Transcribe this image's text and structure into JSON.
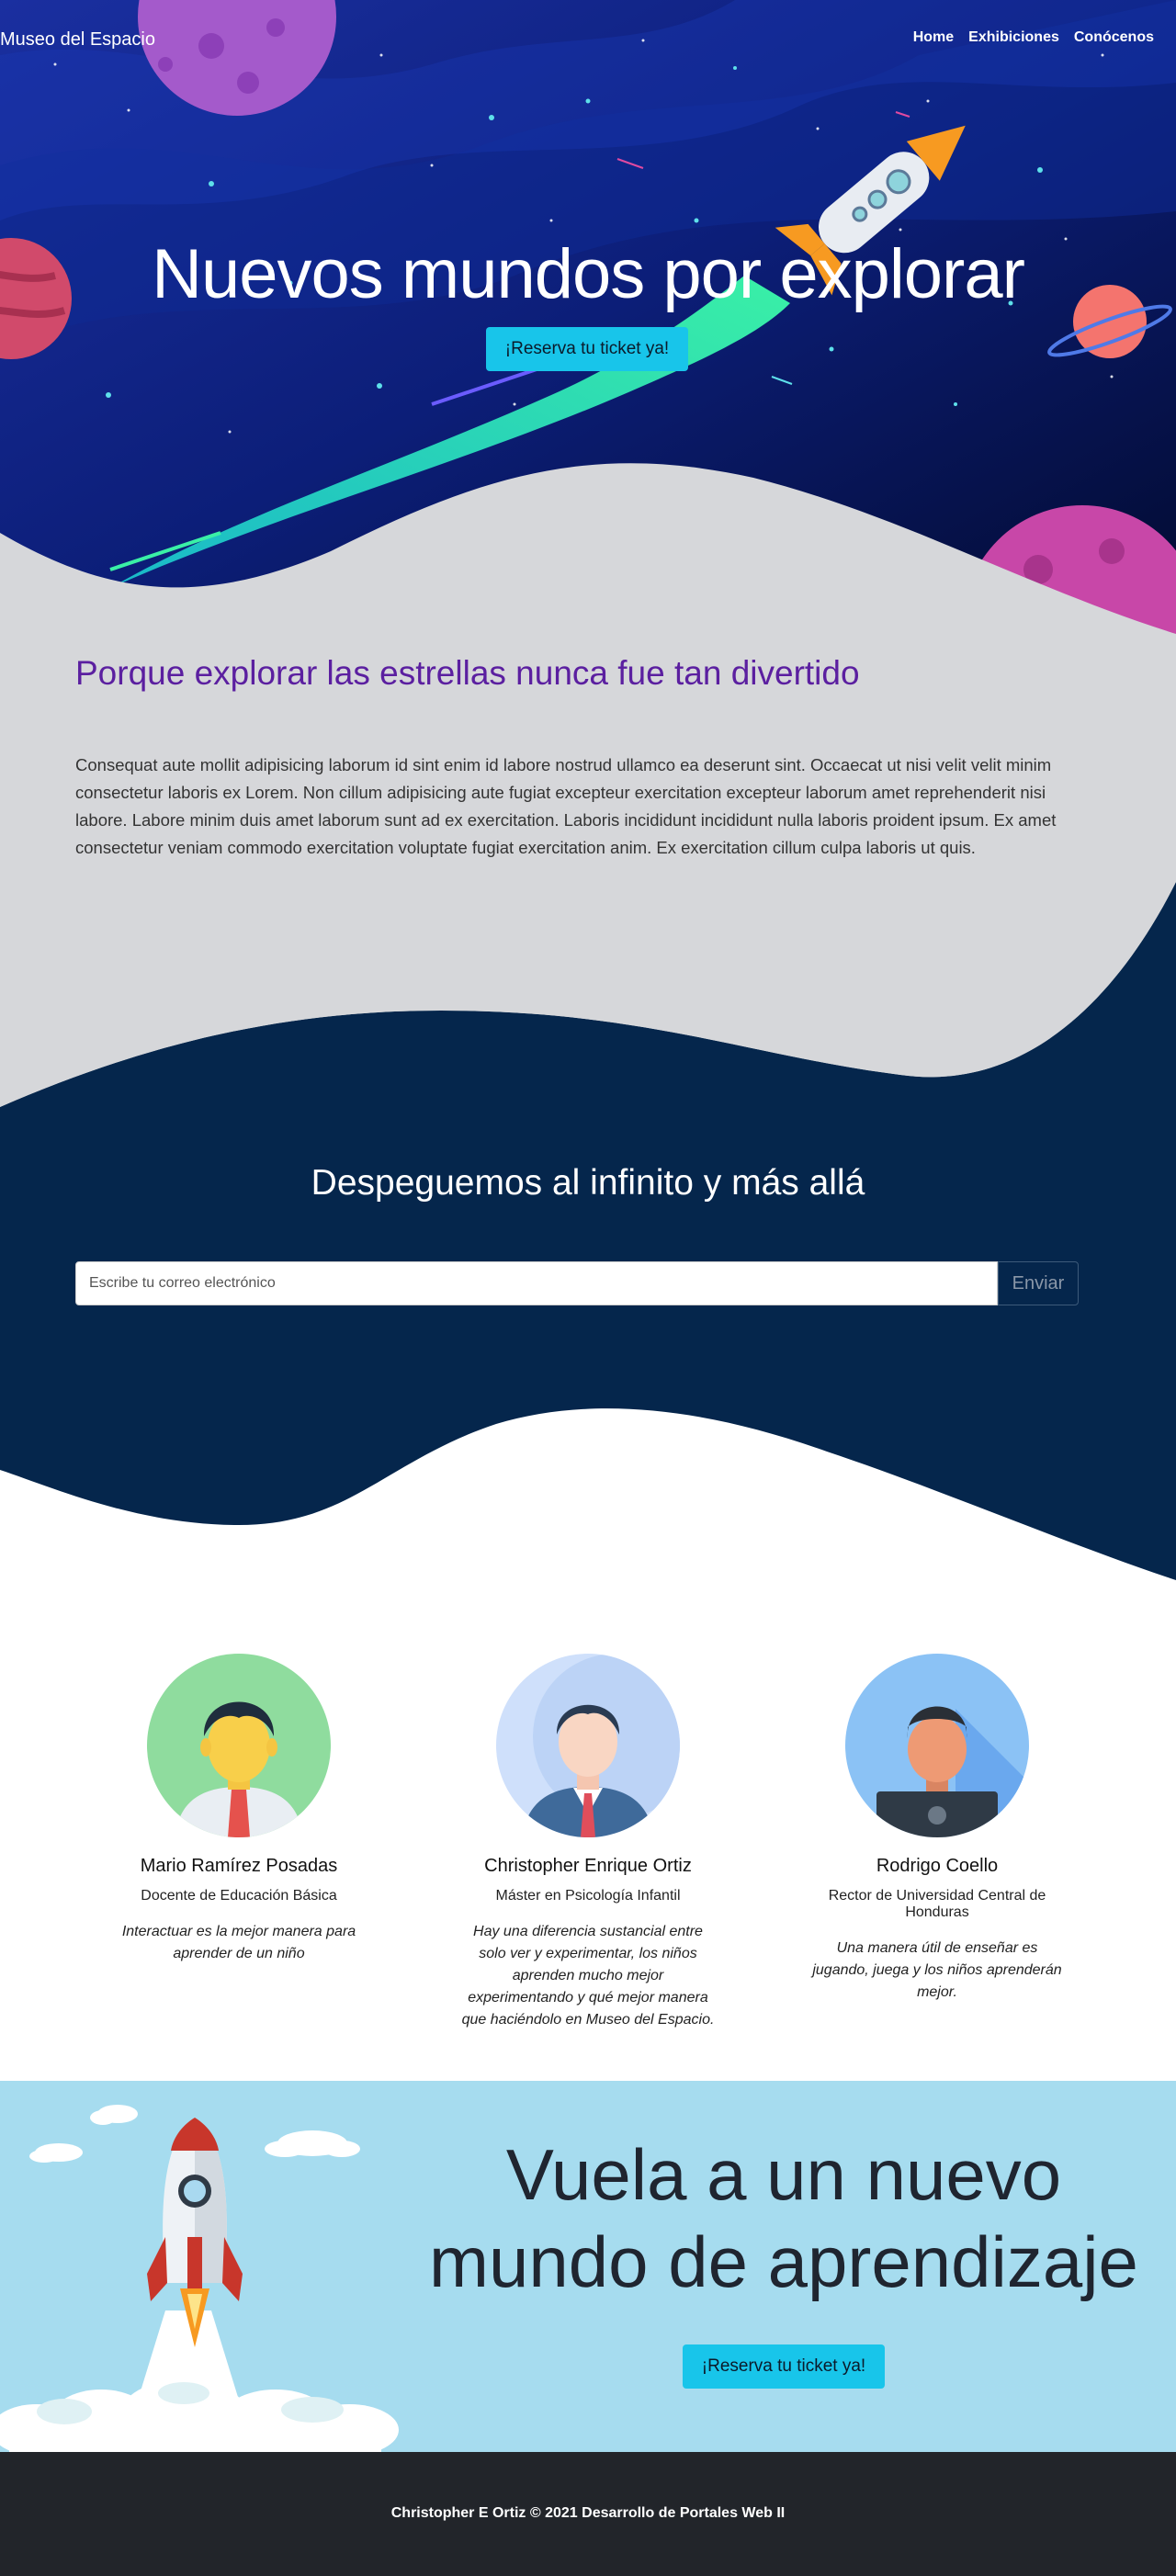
{
  "nav": {
    "brand": "Museo del Espacio",
    "items": [
      "Home",
      "Exhibiciones",
      "Conócenos"
    ]
  },
  "hero": {
    "title": "Nuevos mundos por explorar",
    "cta_label": "¡Reserva tu ticket ya!"
  },
  "about": {
    "title": "Porque explorar las estrellas nunca fue tan divertido",
    "text": "Consequat aute mollit adipisicing laborum id sint enim id labore nostrud ullamco ea deserunt sint. Occaecat ut nisi velit velit minim consectetur laboris ex Lorem. Non cillum adipisicing aute fugiat excepteur exercitation excepteur laborum amet reprehenderit nisi labore. Labore minim duis amet laborum sunt ad ex exercitation. Laboris incididunt incididunt nulla laboris proident ipsum. Ex amet consectetur veniam commodo exercitation voluptate fugiat exercitation anim. Ex exercitation cillum culpa laboris ut quis."
  },
  "newsletter": {
    "title": "Despeguemos al infinito y más allá",
    "placeholder": "Escribe tu correo electrónico",
    "button_label": "Enviar"
  },
  "team": [
    {
      "name": "Mario Ramírez Posadas",
      "role": "Docente de Educación Básica",
      "quote": "Interactuar es la mejor manera para aprender de un niño"
    },
    {
      "name": "Christopher Enrique Ortiz",
      "role": "Máster en Psicología Infantil",
      "quote": "Hay una diferencia sustancial entre solo ver y experimentar, los niños aprenden mucho mejor experimentando y qué mejor manera que haciéndolo en Museo del Espacio."
    },
    {
      "name": "Rodrigo Coello",
      "role": "Rector de Universidad Central de Honduras",
      "quote": "Una manera útil de enseñar es jugando, juega y los niños aprenderán mejor."
    }
  ],
  "cta": {
    "title": "Vuela a un nuevo mundo de aprendizaje",
    "button_label": "¡Reserva tu ticket ya!"
  },
  "footer": {
    "text": "Christopher E Ortiz © 2021 Desarrollo de Portales Web II"
  },
  "colors": {
    "accent_cyan": "#18c5ea",
    "about_title": "#5b1fa0",
    "dark_navy": "#05264c",
    "light_grey": "#d6d7da",
    "cta_sky": "#a6dcef",
    "footer_bg": "#22252a"
  }
}
